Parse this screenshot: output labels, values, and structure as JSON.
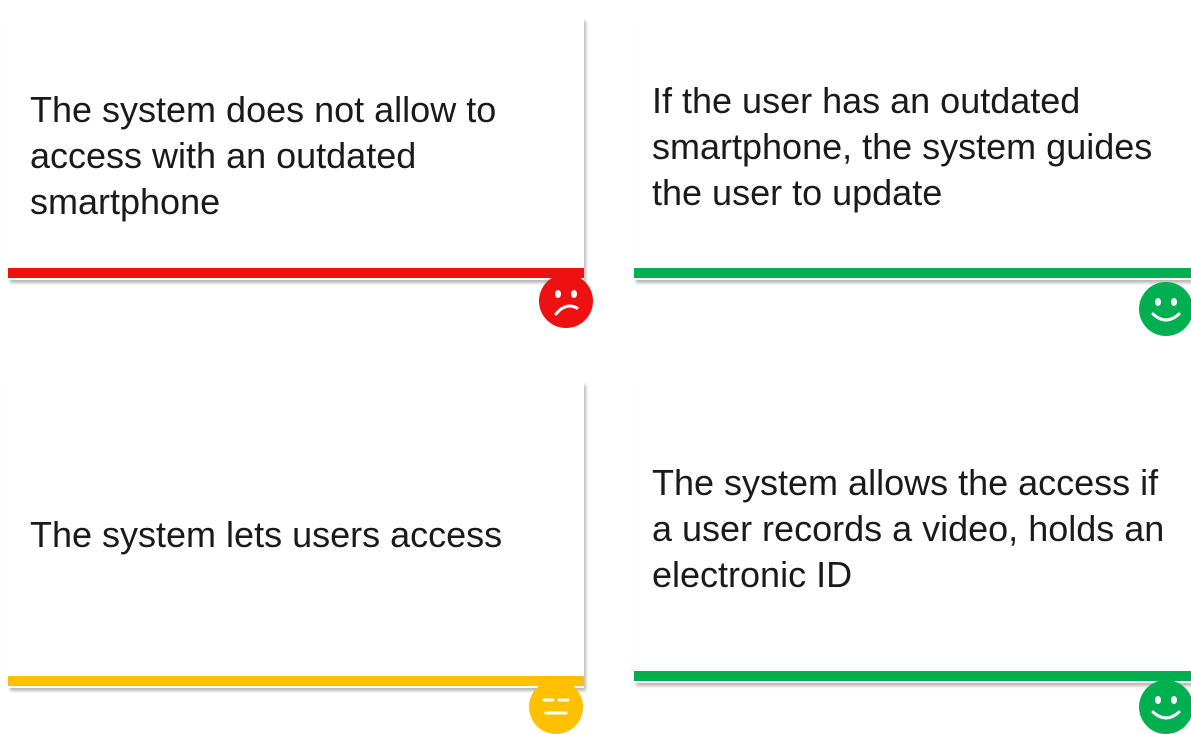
{
  "colors": {
    "red": "#ee1111",
    "green": "#00b050",
    "yellow": "#ffc000",
    "text": "#1a1a1a"
  },
  "cards": [
    {
      "text": "The system does not allow to\naccess with an outdated\nsmartphone",
      "status": "negative",
      "bar_color": "#ee1111",
      "icon": "sad-face-icon"
    },
    {
      "text": "If the user has an outdated\nsmartphone, the system guides\nthe user to update",
      "status": "positive",
      "bar_color": "#00b050",
      "icon": "smiley-face-icon"
    },
    {
      "text": "The system lets users access",
      "status": "neutral",
      "bar_color": "#ffc000",
      "icon": "neutral-face-icon"
    },
    {
      "text": "The system allows the access if\na user records a video, holds an\nelectronic ID",
      "status": "positive",
      "bar_color": "#00b050",
      "icon": "smiley-face-icon"
    }
  ]
}
